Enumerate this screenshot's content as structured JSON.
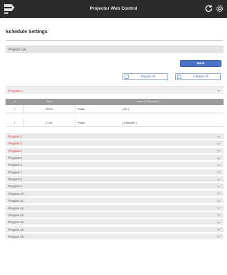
{
  "header": {
    "title": "Projector Web Control",
    "logo_icon": "projector-logo-icon",
    "refresh_icon": "refresh-icon",
    "settings_icon": "gear-icon"
  },
  "page": {
    "title": "Schedule Settings",
    "section_title": "Program List"
  },
  "buttons": {
    "back": "Back",
    "expand_all": "Expand All",
    "collapse_all": "Collapse All"
  },
  "program1": {
    "label": "Program 1",
    "columns": [
      "#",
      "Time",
      "Event ( Parameter )"
    ],
    "rows": [
      {
        "num": "1",
        "time": "08:00",
        "event": "Power",
        "param": "( ON )"
      },
      {
        "num": "2",
        "time": "17:00",
        "event": "Power",
        "param": "( STANDBY )"
      }
    ]
  },
  "programs": [
    {
      "label": "Program 2",
      "highlight": true
    },
    {
      "label": "Program 3",
      "highlight": true
    },
    {
      "label": "Program 4",
      "highlight": true
    },
    {
      "label": "Program 5",
      "highlight": false
    },
    {
      "label": "Program 6",
      "highlight": false
    },
    {
      "label": "Program 7",
      "highlight": false
    },
    {
      "label": "Program 8",
      "highlight": false
    },
    {
      "label": "Program 9",
      "highlight": false
    },
    {
      "label": "Program 10",
      "highlight": false
    },
    {
      "label": "Program 11",
      "highlight": false
    },
    {
      "label": "Program 12",
      "highlight": false
    },
    {
      "label": "Program 13",
      "highlight": false
    },
    {
      "label": "Program 14",
      "highlight": false
    },
    {
      "label": "Program 15",
      "highlight": false
    },
    {
      "label": "Program 16",
      "highlight": false
    }
  ],
  "colors": {
    "header_bg": "#2b2b2b",
    "accent_blue": "#4d73c8",
    "highlight_red": "#d83030"
  }
}
